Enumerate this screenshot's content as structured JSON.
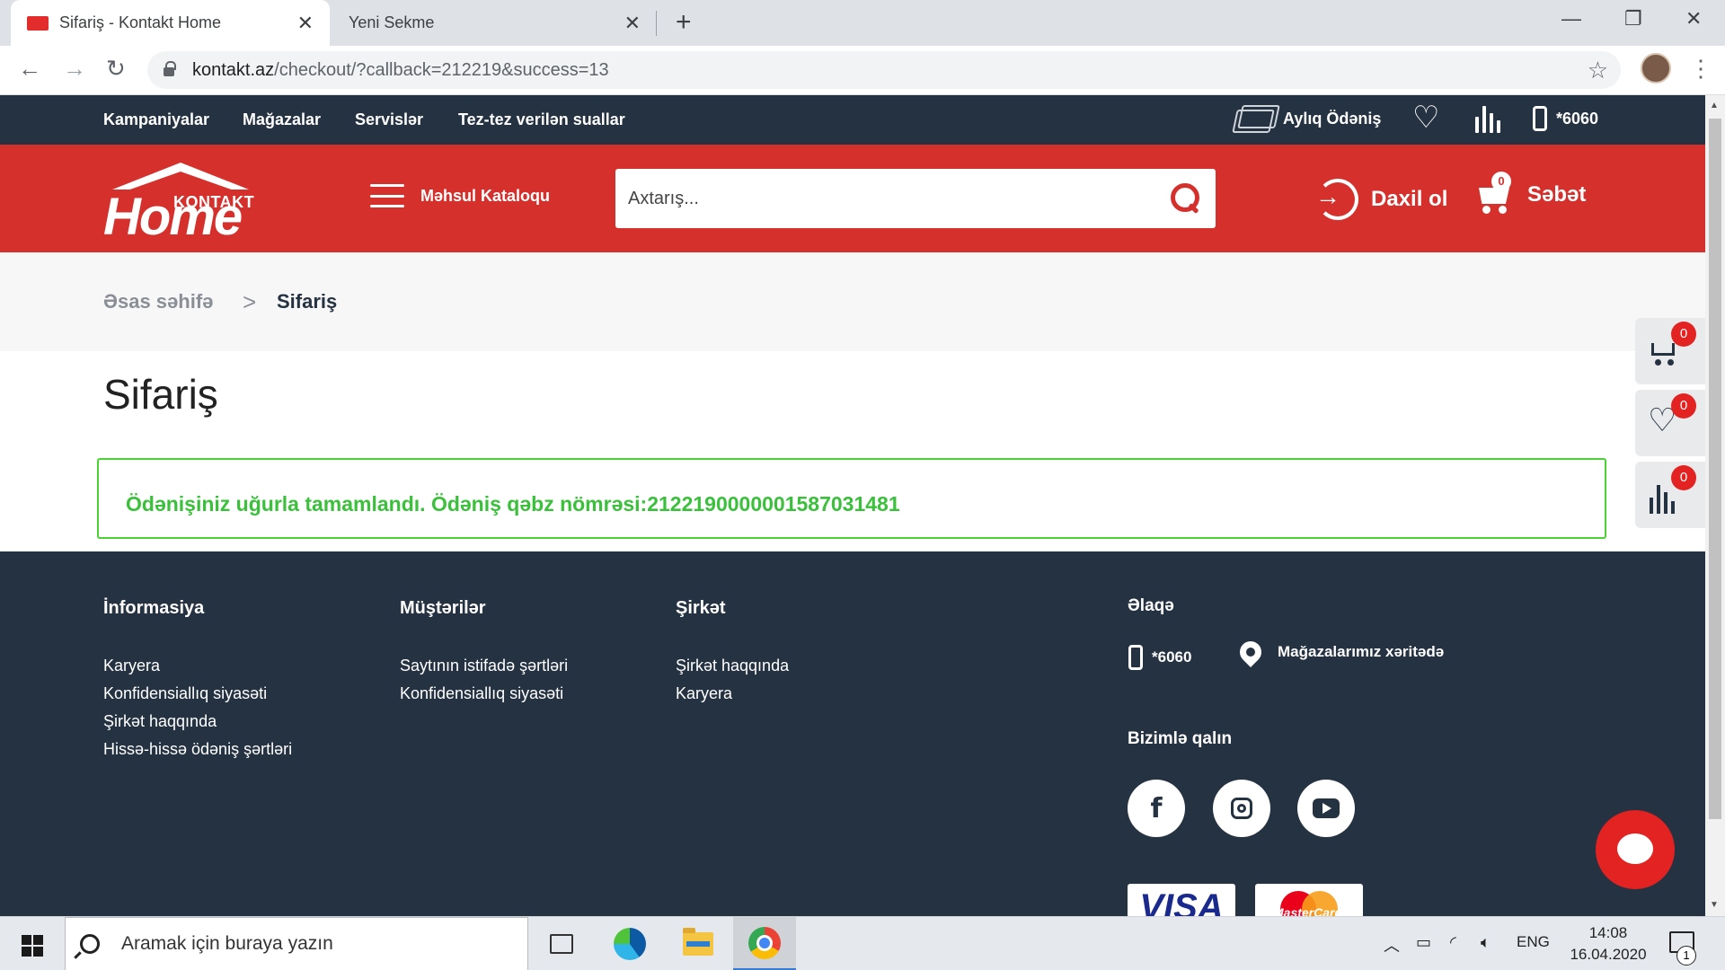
{
  "browser": {
    "tabs": [
      {
        "title": "Sifariş - Kontakt Home",
        "active": true
      },
      {
        "title": "Yeni Sekme",
        "active": false
      }
    ],
    "url_host": "kontakt.az",
    "url_path": "/checkout/?callback=212219&success=13"
  },
  "topbar": {
    "nav": [
      "Kampaniyalar",
      "Mağazalar",
      "Servislər",
      "Tez-tez verilən suallar"
    ],
    "monthly_payment": "Aylıq Ödəniş",
    "phone": "*6060"
  },
  "header": {
    "logo_top": "KONTAKT",
    "logo_main": "Home",
    "catalog": "Məhsul Kataloqu",
    "search_placeholder": "Axtarış...",
    "login": "Daxil ol",
    "cart": "Səbət",
    "cart_count": "0"
  },
  "breadcrumb": {
    "home": "Əsas səhifə",
    "separator": ">",
    "current": "Sifariş"
  },
  "main": {
    "title": "Sifariş",
    "success_message": "Ödənişiniz uğurla tamamlandı. Ödəniş qəbz nömrəsi:2122190000001587031481"
  },
  "side_widgets": {
    "cart_count": "0",
    "wishlist_count": "0",
    "compare_count": "0"
  },
  "footer": {
    "columns": [
      {
        "title": "İnformasiya",
        "links": [
          "Karyera",
          "Konfidensiallıq siyasəti",
          "Şirkət haqqında",
          "Hissə-hissə ödəniş şərtləri"
        ]
      },
      {
        "title": "Müştərilər",
        "links": [
          "Saytının istifadə şərtləri",
          "Konfidensiallıq siyasəti"
        ]
      },
      {
        "title": "Şirkət",
        "links": [
          "Şirkət haqqında",
          "Karyera"
        ]
      }
    ],
    "contact_title": "Əlaqə",
    "contact_phone": "*6060",
    "stores_map": "Mağazalarımız xəritədə",
    "social_title": "Bizimlə qalın",
    "payment_visa": "VISA",
    "payment_mastercard": "MasterCard"
  },
  "taskbar": {
    "search_placeholder": "Aramak için buraya yazın",
    "language": "ENG",
    "time": "14:08",
    "date": "16.04.2020",
    "notification_count": "1"
  },
  "colors": {
    "brand_red": "#d5302c",
    "dark_navy": "#253241",
    "success_green": "#3ac03a"
  }
}
